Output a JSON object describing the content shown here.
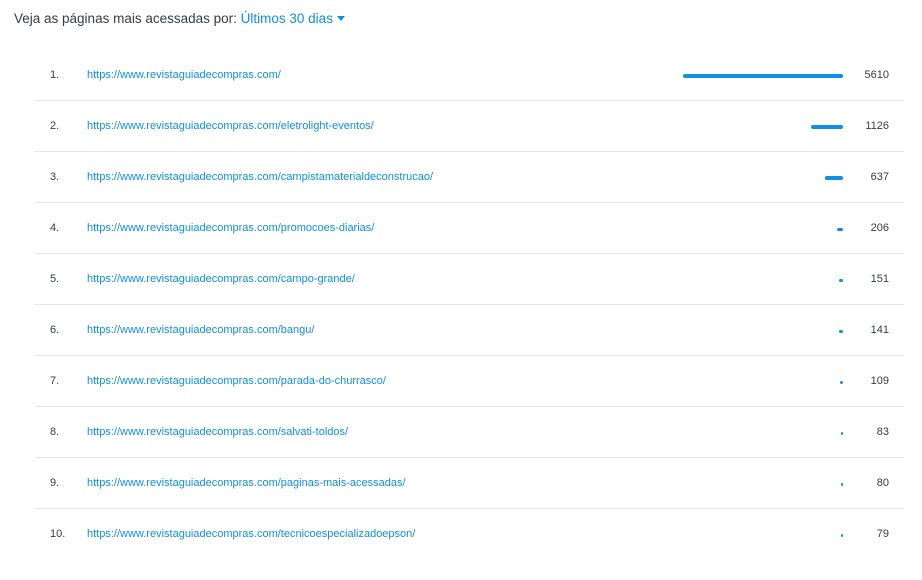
{
  "header": {
    "prefix": "Veja as páginas mais acessadas por:",
    "period": "Últimos 30 dias"
  },
  "colors": {
    "accent": "#0f8fe6",
    "text": "#333c48",
    "divider": "#e6e8eb"
  },
  "pages": [
    {
      "rank": "1.",
      "url": "https://www.revistaguiadecompras.com/",
      "views": 5610
    },
    {
      "rank": "2.",
      "url": "https://www.revistaguiadecompras.com/eletrolight-eventos/",
      "views": 1126
    },
    {
      "rank": "3.",
      "url": "https://www.revistaguiadecompras.com/campistamaterialdeconstrucao/",
      "views": 637
    },
    {
      "rank": "4.",
      "url": "https://www.revistaguiadecompras.com/promocoes-diarias/",
      "views": 206
    },
    {
      "rank": "5.",
      "url": "https://www.revistaguiadecompras.com/campo-grande/",
      "views": 151
    },
    {
      "rank": "6.",
      "url": "https://www.revistaguiadecompras.com/bangu/",
      "views": 141
    },
    {
      "rank": "7.",
      "url": "https://www.revistaguiadecompras.com/parada-do-churrasco/",
      "views": 109
    },
    {
      "rank": "8.",
      "url": "https://www.revistaguiadecompras.com/salvati-toldos/",
      "views": 83
    },
    {
      "rank": "9.",
      "url": "https://www.revistaguiadecompras.com/paginas-mais-acessadas/",
      "views": 80
    },
    {
      "rank": "10.",
      "url": "https://www.revistaguiadecompras.com/tecnicoespecializadoepson/",
      "views": 79
    }
  ]
}
